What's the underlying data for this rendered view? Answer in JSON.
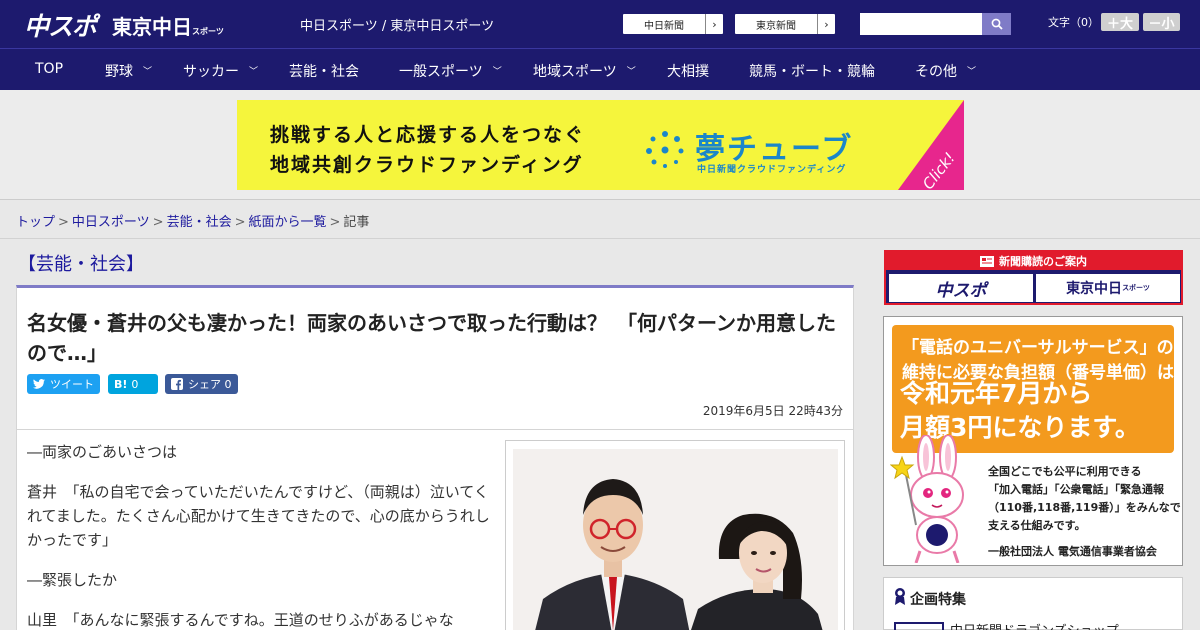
{
  "header": {
    "logo_chuspo": "中スポ",
    "logo_tokyo": "東京中日",
    "logo_tokyo_sub": "スポーツ",
    "site_link": "中日スポーツ / 東京中日スポーツ",
    "ext_links": [
      "中日新聞",
      "東京新聞"
    ],
    "search_placeholder": "",
    "font_size_label": "文字（0）",
    "font_bigger": "＋大",
    "font_smaller": "－小",
    "colors": {
      "navy": "#1d1a6e",
      "accent": "#7f7bc7"
    }
  },
  "nav": {
    "items": [
      {
        "label": "TOP",
        "dropdown": false
      },
      {
        "label": "野球",
        "dropdown": true
      },
      {
        "label": "サッカー",
        "dropdown": true
      },
      {
        "label": "芸能・社会",
        "dropdown": false
      },
      {
        "label": "一般スポーツ",
        "dropdown": true
      },
      {
        "label": "地域スポーツ",
        "dropdown": true
      },
      {
        "label": "大相撲",
        "dropdown": false
      },
      {
        "label": "競馬・ボート・競輪",
        "dropdown": false
      },
      {
        "label": "その他",
        "dropdown": true
      }
    ]
  },
  "banner": {
    "line1": "挑戦する人と応援する人をつなぐ",
    "line2": "地域共創クラウドファンディング",
    "brand": "夢チューブ",
    "brand_sub": "中日新聞クラウドファンディング",
    "click": "Click!"
  },
  "breadcrumb": {
    "items": [
      "トップ",
      "中日スポーツ",
      "芸能・社会",
      "紙面から一覧"
    ],
    "current": "記事"
  },
  "article": {
    "category": "【芸能・社会】",
    "title": "名女優・蒼井の父も凄かった！両家のあいさつで取った行動は？　「何パターンか用意したので…」",
    "share": {
      "tweet": "ツイート",
      "hatena_count": "0",
      "facebook": "シェア",
      "facebook_count": "0"
    },
    "datetime": "2019年6月5日 22時43分",
    "paragraphs": [
      "―両家のごあいさつは",
      "蒼井　「私の自宅で会っていただいたんですけど、（両親は）泣いてくれてました。たくさん心配かけて生きてきたので、心の底からうれしかったです」",
      "―緊張したか",
      "山里　「あんなに緊張するんですね。王道のせりふがあるじゃな"
    ]
  },
  "sidebar": {
    "subscribe_head": "新聞購読のご案内",
    "subscribe_buttons": [
      "中スポ",
      "東京中日"
    ],
    "subscribe_tokyo_sub": "スポーツ",
    "ad": {
      "line1": "「電話のユニバーサルサービス」の",
      "line2": "維持に必要な負担額（番号単価）は",
      "big1": "令和元年7月から",
      "big2": "月額3円になります。",
      "text": [
        "全国どこでも公平に利用できる",
        "「加入電話」「公衆電話」「緊急通報",
        "（110番,118番,119番）」をみんなで",
        "支える仕組みです。"
      ],
      "org": "一般社団法人 電気通信事業者協会"
    },
    "feature_title": "企画特集",
    "feature_item": "中日新聞ドラゴンズショップ"
  }
}
